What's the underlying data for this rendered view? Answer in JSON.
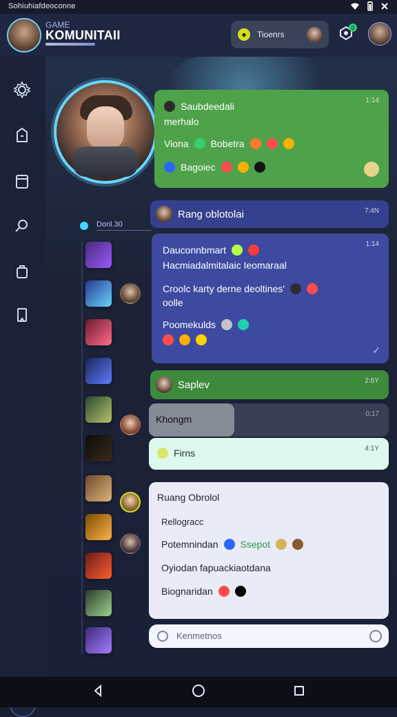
{
  "status_bar": {
    "left_text": "Sohiuhiafdeoconne",
    "right_icons": [
      "wifi-icon",
      "battery-icon",
      "close-icon"
    ]
  },
  "header": {
    "brand_small": "GAME",
    "brand_big": "KOMUNITAII",
    "tokens_label": "Tioenrs",
    "notification_count": "0"
  },
  "sidebar": {
    "items": [
      {
        "name": "settings-icon"
      },
      {
        "name": "shop-icon"
      },
      {
        "name": "calendar-icon"
      },
      {
        "name": "search-icon"
      },
      {
        "name": "inventory-icon"
      },
      {
        "name": "bookmark-icon"
      }
    ],
    "add_button": "+"
  },
  "channel": {
    "pill_label": "Donl.30"
  },
  "messages": [
    {
      "id": "m1",
      "title": "Saubdeedali",
      "subtitle": "merhalo",
      "time": "1:14",
      "line1_prefix": "Viona",
      "line1_item": "Bobetra",
      "line2_text": "Bagoiec",
      "bg": "#4ea24a"
    },
    {
      "id": "m2",
      "title": "Rang oblotolai",
      "time": "7:4N",
      "bg": "#35408f"
    },
    {
      "id": "m3",
      "time": "1:14",
      "lines": [
        "Dauconnbmart",
        "Hacmiadalmitalaic Ieomaraal",
        "Croolc karty derne deoltines'",
        "oolle",
        "Poomekulds"
      ],
      "bg": "#3e4aa0"
    },
    {
      "id": "m4",
      "title": "Saplev",
      "time": "2:6Y",
      "bg": "#3e8a3d"
    },
    {
      "id": "m5",
      "pill_text": "Khongm",
      "time": "0:17",
      "bg": "#3a3f55"
    },
    {
      "id": "m6",
      "title": "Firns",
      "time": "4:1Y",
      "bg": "#dff8ee"
    },
    {
      "id": "m7",
      "title": "Ruang Obrolol",
      "lines": [
        "Rellogracc",
        "Potemnindan",
        "Ssepot",
        "Oyiodan fapuackiaotdana",
        "Biognaridan"
      ],
      "bg": "#e9ecf6"
    }
  ],
  "composer": {
    "placeholder": "Kenmetnos"
  },
  "nav": {
    "back": "back-icon",
    "home": "home-icon",
    "recents": "recents-icon"
  }
}
